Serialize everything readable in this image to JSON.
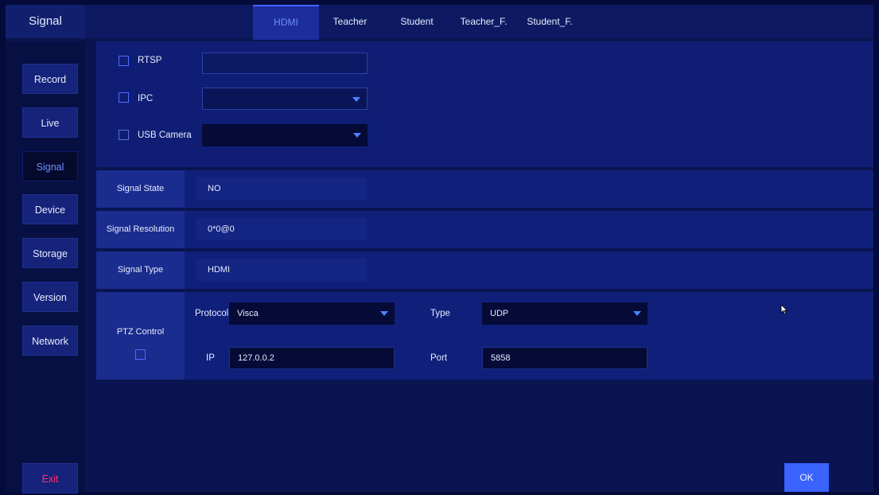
{
  "header": {
    "title": "Signal",
    "tabs": [
      {
        "label": "HDMI",
        "active": true
      },
      {
        "label": "Teacher",
        "active": false
      },
      {
        "label": "Student",
        "active": false
      },
      {
        "label": "Teacher_F.",
        "active": false
      },
      {
        "label": "Student_F.",
        "active": false
      }
    ]
  },
  "sidebar": {
    "items": [
      {
        "label": "Record"
      },
      {
        "label": "Live"
      },
      {
        "label": "Signal",
        "active": true
      },
      {
        "label": "Device"
      },
      {
        "label": "Storage"
      },
      {
        "label": "Version"
      },
      {
        "label": "Network"
      }
    ],
    "exit_label": "Exit"
  },
  "source": {
    "rtsp_label": "RTSP",
    "rtsp_value": "",
    "ipc_label": "IPC",
    "ipc_value": "",
    "usb_label": "USB Camera",
    "usb_value": ""
  },
  "status": {
    "state_label": "Signal State",
    "state_value": "NO",
    "resolution_label": "Signal Resolution",
    "resolution_value": "0*0@0",
    "type_label": "Signal Type",
    "type_value": "HDMI"
  },
  "ptz": {
    "label": "PTZ Control",
    "protocol_label": "Protocol",
    "protocol_value": "Visca",
    "type_label": "Type",
    "type_value": "UDP",
    "ip_label": "IP",
    "ip_value": "127.0.0.2",
    "port_label": "Port",
    "port_value": "5858"
  },
  "footer": {
    "ok_label": "OK"
  },
  "colors": {
    "accent": "#3a63ff",
    "exit": "#ff2f6e",
    "active_text": "#6e8cff",
    "background": "#0a1450"
  }
}
